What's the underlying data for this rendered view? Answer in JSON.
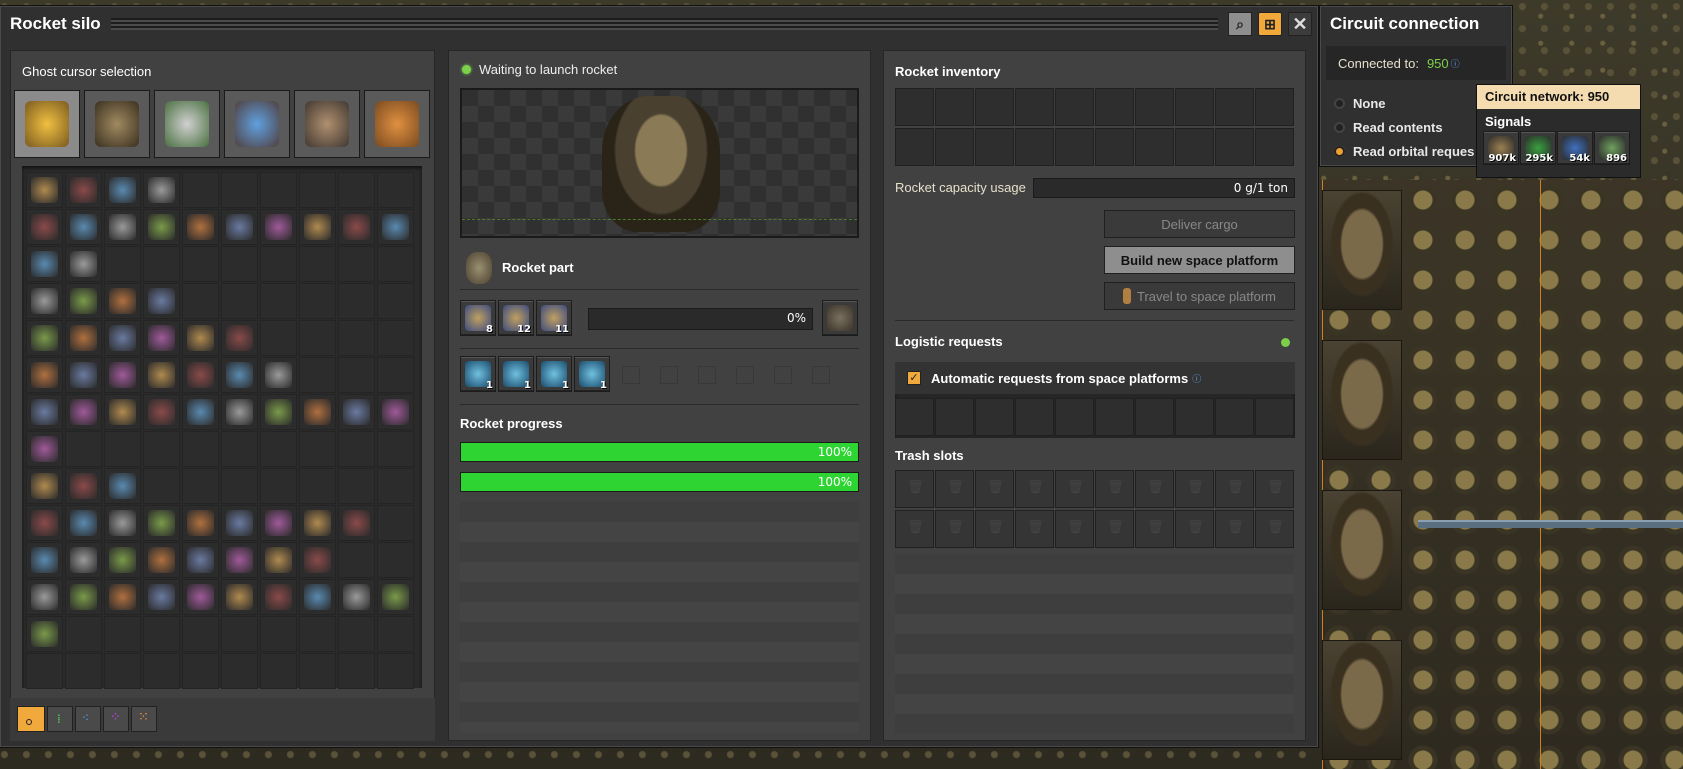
{
  "window": {
    "title": "Rocket silo"
  },
  "ghost": {
    "title": "Ghost cursor selection",
    "tabs": [
      "logistics-icon",
      "production-icon",
      "intermediates-icon",
      "space-icon",
      "combat-icon",
      "unsorted-icon"
    ],
    "quality": [
      "normal-quality-icon",
      "uncommon-quality-icon",
      "rare-quality-icon",
      "epic-quality-icon",
      "legendary-quality-icon"
    ]
  },
  "status": {
    "text": "Waiting to launch rocket",
    "color": "#7dd04a"
  },
  "recipe": {
    "name": "Rocket part"
  },
  "ingredients": [
    {
      "icon": "processing-unit-icon",
      "count": "8"
    },
    {
      "icon": "low-density-structure-icon",
      "count": "12"
    },
    {
      "icon": "rocket-fuel-icon",
      "count": "11"
    }
  ],
  "craft": {
    "percent": "0%"
  },
  "modules": [
    {
      "icon": "productivity-module-icon",
      "count": "1"
    },
    {
      "icon": "productivity-module-icon",
      "count": "1"
    },
    {
      "icon": "productivity-module-icon",
      "count": "1"
    },
    {
      "icon": "productivity-module-icon",
      "count": "1"
    }
  ],
  "rocket_progress": {
    "label": "Rocket progress",
    "bars": [
      {
        "text": "100%",
        "value": 1.0
      },
      {
        "text": "100%",
        "value": 1.0
      }
    ]
  },
  "inventory": {
    "title": "Rocket inventory",
    "capacity_label": "Rocket capacity usage",
    "capacity_value": "0 g/1 ton",
    "deliver": "Deliver cargo",
    "build": "Build new space platform",
    "travel": "Travel to space platform"
  },
  "logistic": {
    "title": "Logistic requests",
    "auto": "Automatic requests from space platforms",
    "trash": "Trash slots"
  },
  "circuit": {
    "title": "Circuit connection",
    "connected_label": "Connected to:",
    "connected_value": "950",
    "options": [
      "None",
      "Read contents",
      "Read orbital reques"
    ],
    "selected": 2
  },
  "tooltip": {
    "title": "Circuit network: 950",
    "signals_label": "Signals",
    "signals": [
      {
        "icon": "rocket-part-icon",
        "value": "907k"
      },
      {
        "icon": "green-circuit-icon",
        "value": "295k"
      },
      {
        "icon": "processing-unit-icon",
        "value": "54k"
      },
      {
        "icon": "satellite-icon",
        "value": "896"
      }
    ]
  },
  "colors": {
    "accent": "#f2a93b",
    "progress": "#2ed432",
    "signal_green": "#7dd04a"
  }
}
